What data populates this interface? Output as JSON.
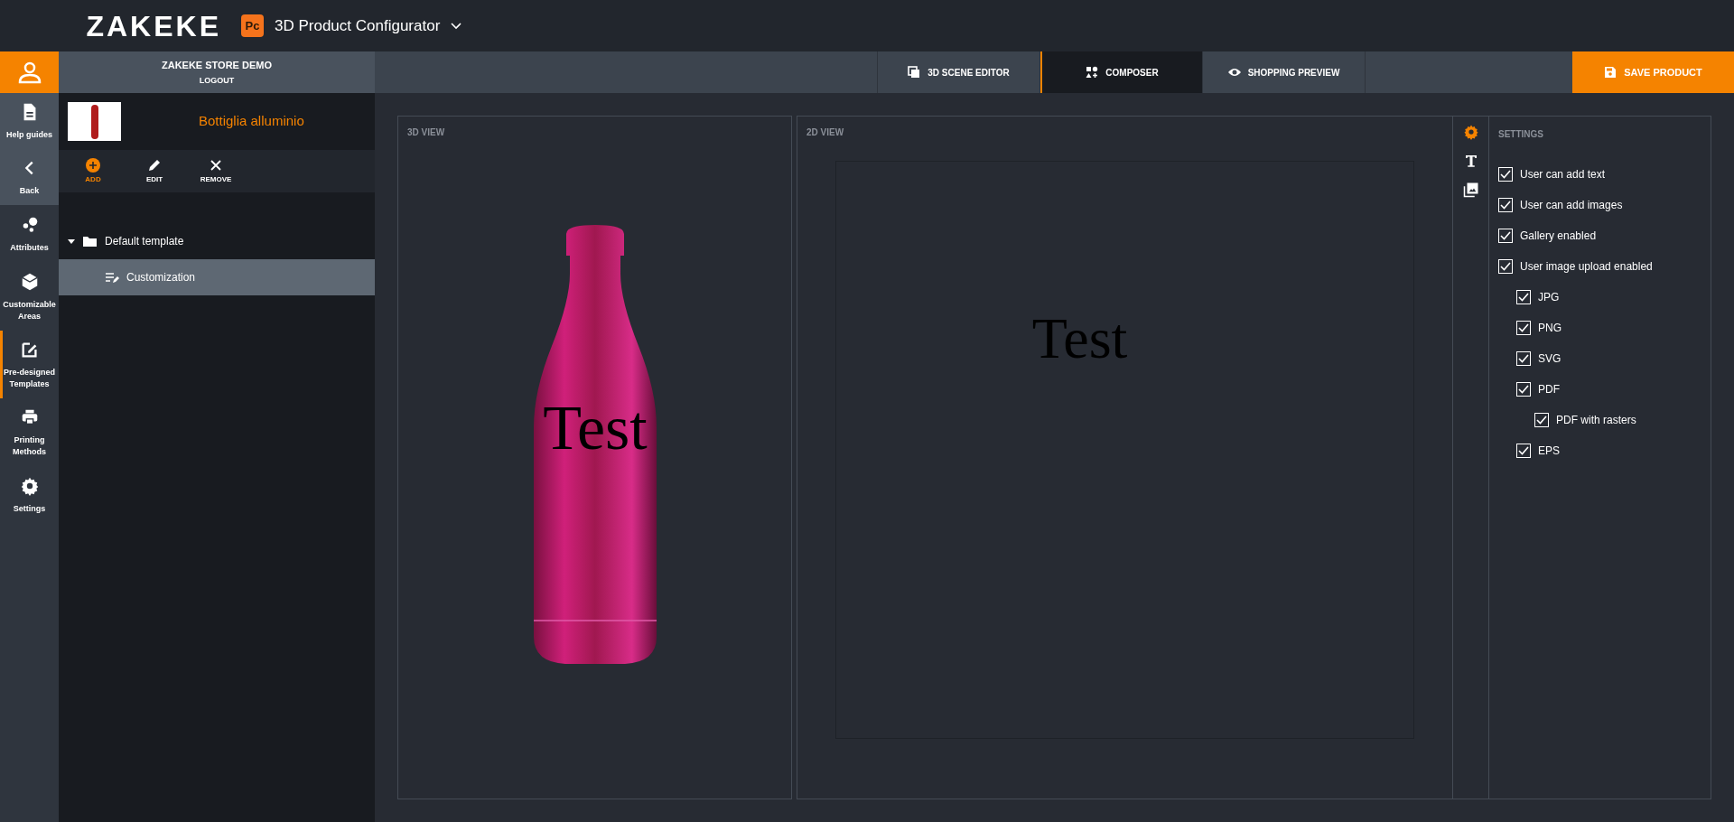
{
  "header": {
    "logo": "ZAKEKE",
    "app_badge": "Pc",
    "app_title": "3D Product Configurator"
  },
  "account": {
    "store": "ZAKEKE STORE DEMO",
    "logout": "LOGOUT"
  },
  "rail": [
    {
      "kind": "help",
      "label": "Help guides",
      "selected": false
    },
    {
      "kind": "back",
      "label": "Back",
      "selected": false
    },
    {
      "kind": "attributes",
      "label": "Attributes",
      "selected": false
    },
    {
      "kind": "areas",
      "label": "Customizable Areas",
      "selected": false
    },
    {
      "kind": "templates",
      "label": "Pre-designed Templates",
      "selected": true
    },
    {
      "kind": "printing",
      "label": "Printing Methods",
      "selected": false
    },
    {
      "kind": "settings",
      "label": "Settings",
      "selected": false
    }
  ],
  "tabs": [
    {
      "kind": "scene",
      "label": "3D SCENE EDITOR",
      "selected": false
    },
    {
      "kind": "composer",
      "label": "COMPOSER",
      "selected": true
    },
    {
      "kind": "preview",
      "label": "SHOPPING PREVIEW",
      "selected": false
    }
  ],
  "save_button": "SAVE PRODUCT",
  "product": {
    "name": "Bottiglia alluminio"
  },
  "toolbar": [
    {
      "kind": "add",
      "label": "ADD"
    },
    {
      "kind": "edit",
      "label": "EDIT"
    },
    {
      "kind": "remove",
      "label": "REMOVE"
    }
  ],
  "tree": [
    {
      "label": "Default template",
      "expanded": true,
      "children": [
        {
          "label": "Customization",
          "selected": true
        }
      ]
    }
  ],
  "view_3d": {
    "title": "3D VIEW",
    "decal_text": "Test"
  },
  "view_2d": {
    "title": "2D VIEW",
    "canvas_text": "Test"
  },
  "side_tools": [
    {
      "kind": "settings",
      "selected": true
    },
    {
      "kind": "text",
      "selected": false
    },
    {
      "kind": "images",
      "selected": false
    }
  ],
  "settings": {
    "title": "SETTINGS",
    "options": [
      {
        "label": "User can add text",
        "checked": true
      },
      {
        "label": "User can add images",
        "checked": true
      },
      {
        "label": "Gallery enabled",
        "checked": true
      },
      {
        "label": "User image upload enabled",
        "checked": true,
        "children": [
          {
            "label": "JPG",
            "checked": true
          },
          {
            "label": "PNG",
            "checked": true
          },
          {
            "label": "SVG",
            "checked": true
          },
          {
            "label": "PDF",
            "checked": true,
            "children": [
              {
                "label": "PDF with rasters",
                "checked": true
              }
            ]
          },
          {
            "label": "EPS",
            "checked": true
          }
        ]
      }
    ]
  }
}
